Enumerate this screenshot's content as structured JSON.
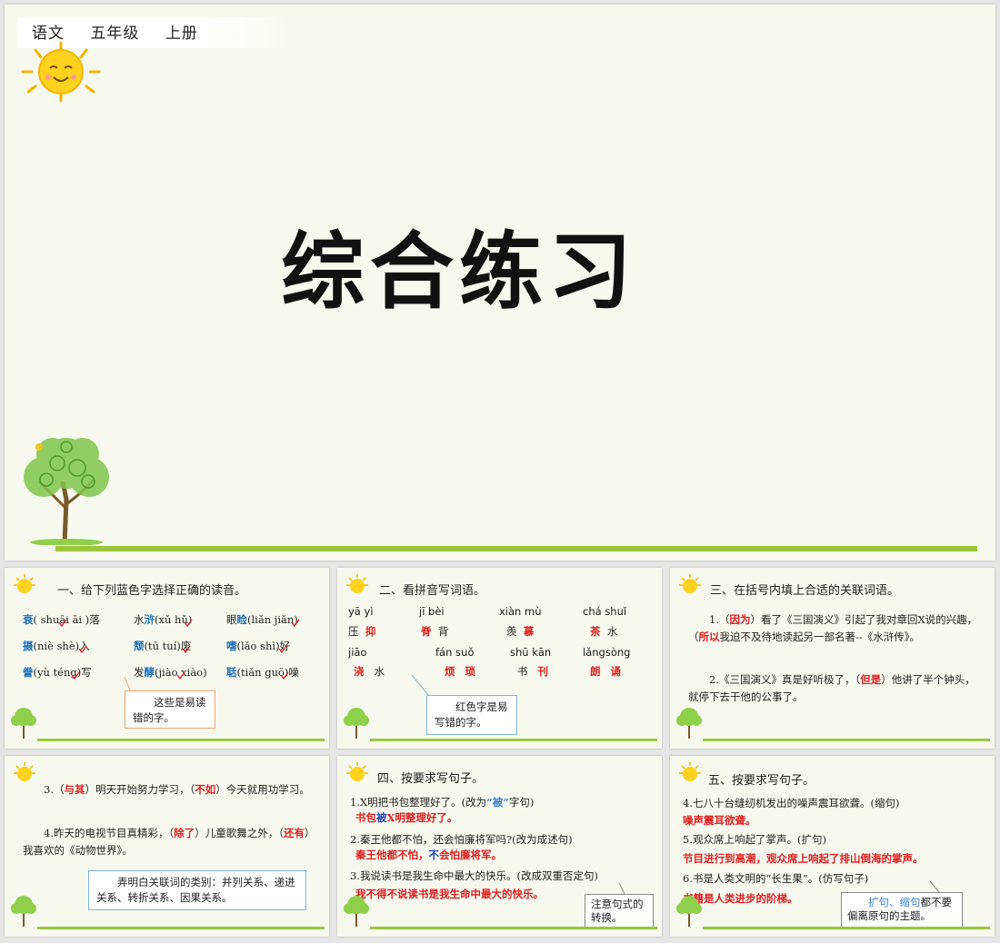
{
  "header": {
    "subject": "语文",
    "grade": "五年级",
    "volume": "上册"
  },
  "main_title": "综合练习",
  "s1": {
    "title": "一、给下列蓝色字选择正确的读音。",
    "rows": [
      [
        {
          "c": "衰",
          "p": "( shuāi āi )落"
        },
        {
          "c": "浒",
          "pre": "水",
          "p": "(xǔ hǔ)"
        },
        {
          "c": "睑",
          "pre": "眼",
          "p": "(liǎn jiǎn)"
        }
      ],
      [
        {
          "c": "摄",
          "p": "(niè shè)入"
        },
        {
          "c": "颓",
          "p": "(tū tuí)废"
        },
        {
          "c": "嗜",
          "p": "(lǎo shì)好"
        }
      ],
      [
        {
          "c": "誊",
          "p": "(yù téng)写"
        },
        {
          "c": "酵",
          "pre": "发",
          "p": "(jiào xiào)"
        },
        {
          "c": "聒",
          "p": "(tiǎn guō)噪"
        }
      ]
    ],
    "note": "这些是易读错的字。"
  },
  "s2": {
    "title": "二、看拼音写词语。",
    "pinyin_row1": [
      "yā yì",
      "jī bèi",
      "xiàn mù",
      "chá shuǐ"
    ],
    "words_row1": [
      [
        "压",
        "抑"
      ],
      [
        "脊",
        "背"
      ],
      [
        "羡",
        "慕"
      ],
      [
        "茶",
        "水"
      ]
    ],
    "pinyin_row2": [
      "jiāo",
      "fán suǒ",
      "shū kān",
      "lǎngsòng"
    ],
    "words_row2": [
      [
        "浇",
        "水"
      ],
      [
        "烦",
        "琐"
      ],
      [
        "书",
        "刊"
      ],
      [
        "朗",
        "诵"
      ]
    ],
    "note": "红色字是易写错的字。"
  },
  "s3": {
    "title": "三、在括号内填上合适的关联词语。",
    "q1_a": "1.（",
    "q1_ans1": "因为",
    "q1_b": "）看了《三国演义》引起了我对章回X说的兴趣，（",
    "q1_ans2": "所以",
    "q1_c": "我迫不及待地读起另一部名著--《水浒传》。",
    "q2_a": "2.《三国演义》真是好听极了，（",
    "q2_ans": "但是",
    "q2_b": "）他讲了半个钟头，就停下去干他的公事了。"
  },
  "s4": {
    "q3_a": "3.（",
    "q3_ans1": "与其",
    "q3_b": "）明天开始努力学习，（",
    "q3_ans2": "不如",
    "q3_c": "）今天就用功学习。",
    "q4_a": "4.昨天的电视节目真精彩，（",
    "q4_ans1": "除了",
    "q4_b": "）儿童歌舞之外，（",
    "q4_ans2": "还有",
    "q4_c": "）我喜欢的《动物世界》。",
    "note": "弄明白关联词的类别：并列关系、递进关系、转折关系、因果关系。"
  },
  "s5": {
    "title": "四、按要求写句子。",
    "q1": "1.X明把书包整理好了。(改为",
    "q1_key": "“被”",
    "q1_end": "字句)",
    "a1_a": "书包",
    "a1_key": "被",
    "a1_b": "X明整理好了。",
    "q2": "2.秦王他都不怕，还会怕廉将军吗?(改为成述句)",
    "a2_a": "秦王他都不怕，",
    "a2_key": "不",
    "a2_b": "会怕廉将军。",
    "q3": "3.我说读书是我生命中最大的快乐。(改成双重否定句)",
    "a3": "我不得不说读书是我生命中最大的快乐。",
    "note": "注意句式的转换。"
  },
  "s6": {
    "title": "五、按要求写句子。",
    "q4": "4.七八十台缝纫机发出的噪声震耳欲聋。(缩句)",
    "a4": "噪声震耳欲聋。",
    "q5": "5.观众席上响起了掌声。(扩句)",
    "a5": "节目进行到高潮，观众席上响起了排山倒海的掌声。",
    "q6": "6.书是人类文明的“长生果”。(仿写句子)",
    "a6": "书籍是人类进步的阶梯。",
    "note_key": "扩句、缩句",
    "note_rest": "都不要偏离原句的主题。"
  },
  "colors": {
    "accent_green": "#9bc53d",
    "red": "#e02020",
    "blue": "#1d6fb8"
  }
}
